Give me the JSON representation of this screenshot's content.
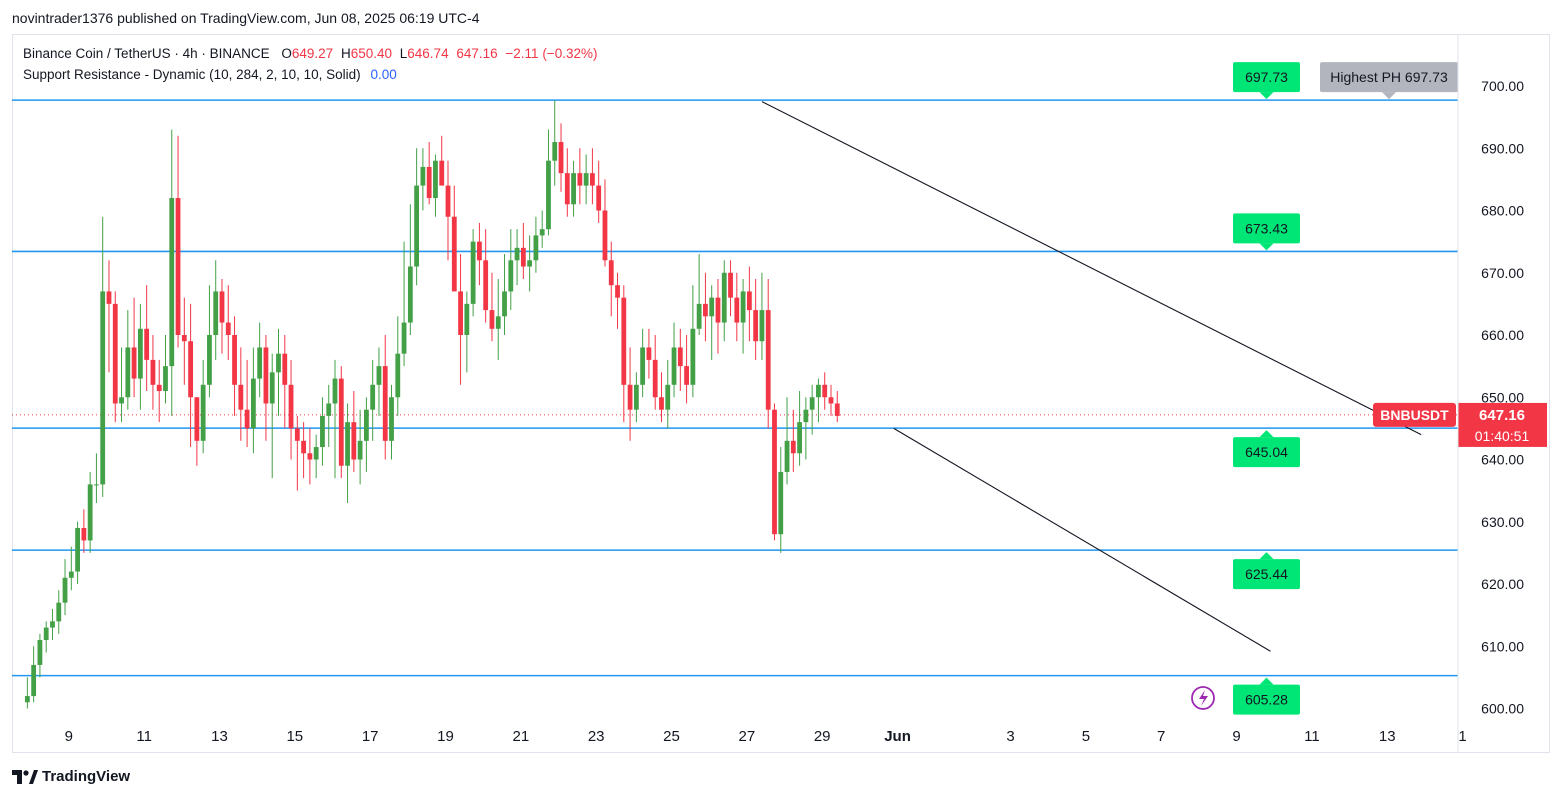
{
  "publisher_line": "novintrader1376 published on TradingView.com, Jun 08, 2025 06:19 UTC-4",
  "legend": {
    "symbol": "Binance Coin / TetherUS · 4h · BINANCE",
    "o_label": "O",
    "o_value": "649.27",
    "h_label": "H",
    "h_value": "650.40",
    "l_label": "L",
    "l_value": "646.74",
    "c_value": "647.16",
    "change": "−2.11 (−0.32%)",
    "indicator": "Support Resistance - Dynamic (10, 284, 2, 10, 10, Solid)",
    "indicator_value": "0.00"
  },
  "brand": "TradingView",
  "colors": {
    "up": "#43a047",
    "down": "#f23645",
    "level": "#2196f3",
    "label_green": "#00e676",
    "trend": "#131722",
    "price_tag": "#f23645"
  },
  "chart_data": {
    "type": "candlestick",
    "symbol": "BNBUSDT",
    "y_ticks": [
      "700.00",
      "690.00",
      "680.00",
      "670.00",
      "660.00",
      "650.00",
      "640.00",
      "630.00",
      "620.00",
      "610.00",
      "600.00"
    ],
    "ylim": [
      598,
      703
    ],
    "x_ticks": [
      "9",
      "11",
      "13",
      "15",
      "17",
      "19",
      "21",
      "23",
      "25",
      "27",
      "29",
      "Jun",
      "3",
      "5",
      "7",
      "9",
      "11",
      "13",
      "1"
    ],
    "x_tick_day_index": [
      9,
      11,
      13,
      15,
      17,
      19,
      21,
      23,
      25,
      27,
      29,
      31,
      34,
      36,
      38,
      40,
      42,
      44,
      46
    ],
    "current_price": "647.16",
    "countdown": "01:40:51",
    "symbol_tag": "BNBUSDT",
    "levels": [
      {
        "value": 697.73,
        "label": "697.73"
      },
      {
        "value": 673.43,
        "label": "673.43"
      },
      {
        "value": 645.04,
        "label": "645.04"
      },
      {
        "value": 625.44,
        "label": "625.44"
      },
      {
        "value": 605.28,
        "label": "605.28"
      }
    ],
    "highest_ph_label": "Highest PH 697.73",
    "trendlines": [
      {
        "from": {
          "day": 27.4,
          "price": 697.5
        },
        "to": {
          "day": 44.9,
          "price": 644.0
        }
      },
      {
        "from": {
          "day": 30.9,
          "price": 645.0
        },
        "to": {
          "day": 40.9,
          "price": 609.2
        }
      }
    ],
    "candles_day_start": 7.9,
    "candles_per_day": 6,
    "candles": [
      [
        601,
        605,
        600,
        602
      ],
      [
        602,
        610,
        601,
        607
      ],
      [
        607,
        612,
        605,
        611
      ],
      [
        611,
        614,
        609,
        613
      ],
      [
        613,
        616,
        611,
        614
      ],
      [
        614,
        619,
        612,
        617
      ],
      [
        617,
        624,
        615,
        621
      ],
      [
        621,
        626,
        619,
        622
      ],
      [
        622,
        630,
        620,
        629
      ],
      [
        629,
        632,
        625,
        627
      ],
      [
        627,
        638,
        625,
        636
      ],
      [
        636,
        641,
        633,
        636
      ],
      [
        636,
        679,
        634,
        667
      ],
      [
        667,
        672,
        654,
        665
      ],
      [
        665,
        667,
        646,
        649
      ],
      [
        649,
        658,
        646,
        650
      ],
      [
        650,
        664,
        648,
        658
      ],
      [
        658,
        666,
        650,
        653
      ],
      [
        653,
        665,
        648,
        661
      ],
      [
        661,
        668,
        651,
        656
      ],
      [
        656,
        660,
        648,
        652
      ],
      [
        652,
        656,
        646,
        651
      ],
      [
        651,
        660,
        649,
        655
      ],
      [
        655,
        693,
        647,
        682
      ],
      [
        682,
        692,
        658,
        660
      ],
      [
        660,
        666,
        652,
        659
      ],
      [
        659,
        665,
        642,
        650
      ],
      [
        650,
        650,
        639,
        643
      ],
      [
        643,
        656,
        641,
        652
      ],
      [
        652,
        668,
        650,
        660
      ],
      [
        660,
        672,
        656,
        667
      ],
      [
        667,
        669,
        657,
        662
      ],
      [
        662,
        668,
        656,
        660
      ],
      [
        660,
        663,
        647,
        652
      ],
      [
        652,
        658,
        643,
        648
      ],
      [
        648,
        656,
        642,
        645
      ],
      [
        645,
        658,
        641,
        653
      ],
      [
        653,
        662,
        650,
        658
      ],
      [
        658,
        660,
        643,
        649
      ],
      [
        649,
        657,
        637,
        654
      ],
      [
        654,
        661,
        647,
        657
      ],
      [
        657,
        660,
        645,
        652
      ],
      [
        652,
        656,
        640,
        645
      ],
      [
        645,
        647,
        635,
        643
      ],
      [
        643,
        646,
        637,
        641
      ],
      [
        641,
        645,
        636,
        640
      ],
      [
        640,
        644,
        637,
        642
      ],
      [
        642,
        650,
        639,
        647
      ],
      [
        647,
        652,
        642,
        649
      ],
      [
        649,
        656,
        637,
        653
      ],
      [
        653,
        655,
        637,
        639
      ],
      [
        639,
        649,
        633,
        646
      ],
      [
        646,
        651,
        638,
        640
      ],
      [
        640,
        648,
        636,
        643
      ],
      [
        643,
        650,
        638,
        648
      ],
      [
        648,
        656,
        643,
        652
      ],
      [
        652,
        658,
        647,
        655
      ],
      [
        655,
        660,
        640,
        643
      ],
      [
        643,
        652,
        640,
        650
      ],
      [
        650,
        663,
        647,
        657
      ],
      [
        657,
        675,
        655,
        662
      ],
      [
        662,
        681,
        660,
        671
      ],
      [
        671,
        690,
        668,
        684
      ],
      [
        684,
        690,
        680,
        687
      ],
      [
        687,
        691,
        681,
        682
      ],
      [
        682,
        689,
        679,
        688
      ],
      [
        688,
        692,
        684,
        684
      ],
      [
        684,
        688,
        672,
        679
      ],
      [
        679,
        684,
        669,
        667
      ],
      [
        667,
        673,
        652,
        660
      ],
      [
        660,
        667,
        654,
        665
      ],
      [
        665,
        677,
        663,
        675
      ],
      [
        675,
        678,
        668,
        672
      ],
      [
        672,
        677,
        662,
        664
      ],
      [
        664,
        670,
        659,
        661
      ],
      [
        661,
        669,
        656,
        663
      ],
      [
        663,
        673,
        660,
        667
      ],
      [
        667,
        677,
        664,
        672
      ],
      [
        672,
        677,
        668,
        674
      ],
      [
        674,
        678,
        669,
        671
      ],
      [
        671,
        676,
        667,
        672
      ],
      [
        672,
        679,
        670,
        676
      ],
      [
        676,
        680,
        674,
        677
      ],
      [
        677,
        693,
        676,
        688
      ],
      [
        688,
        697.7,
        684,
        691
      ],
      [
        691,
        694,
        683,
        686
      ],
      [
        686,
        690,
        679,
        681
      ],
      [
        681,
        688,
        679,
        686
      ],
      [
        686,
        690,
        681,
        684
      ],
      [
        684,
        689,
        681,
        686
      ],
      [
        686,
        690,
        681,
        684
      ],
      [
        684,
        688,
        678,
        680
      ],
      [
        680,
        685,
        671,
        672
      ],
      [
        672,
        675,
        663,
        668
      ],
      [
        668,
        670,
        661,
        666
      ],
      [
        666,
        668,
        646,
        652
      ],
      [
        652,
        658,
        643,
        648
      ],
      [
        648,
        654,
        646,
        652
      ],
      [
        652,
        661,
        650,
        658
      ],
      [
        658,
        661,
        653,
        656
      ],
      [
        656,
        660,
        648,
        650
      ],
      [
        650,
        654,
        646,
        648
      ],
      [
        648,
        656,
        645,
        652
      ],
      [
        652,
        662,
        650,
        658
      ],
      [
        658,
        661,
        651,
        655
      ],
      [
        655,
        660,
        649,
        652
      ],
      [
        652,
        668,
        650,
        661
      ],
      [
        661,
        673,
        660,
        665
      ],
      [
        665,
        670,
        659,
        663
      ],
      [
        663,
        668,
        656,
        666
      ],
      [
        666,
        669,
        657,
        662
      ],
      [
        662,
        672,
        659,
        670
      ],
      [
        670,
        672,
        663,
        666
      ],
      [
        666,
        670,
        659,
        662
      ],
      [
        662,
        669,
        657,
        667
      ],
      [
        667,
        671,
        659,
        664
      ],
      [
        664,
        669,
        656,
        659
      ],
      [
        659,
        670,
        656,
        664
      ],
      [
        664,
        669,
        645,
        648
      ],
      [
        648,
        649,
        627,
        628
      ],
      [
        628,
        642,
        625,
        638
      ],
      [
        638,
        650,
        636,
        643
      ],
      [
        643,
        648,
        638,
        641
      ],
      [
        641,
        651,
        639,
        646
      ],
      [
        646,
        650,
        640,
        648
      ],
      [
        648,
        652,
        644,
        650
      ],
      [
        650,
        653,
        646,
        652
      ],
      [
        652,
        654,
        648,
        650
      ],
      [
        650,
        652,
        647,
        649
      ],
      [
        649,
        651,
        646,
        647
      ]
    ]
  }
}
